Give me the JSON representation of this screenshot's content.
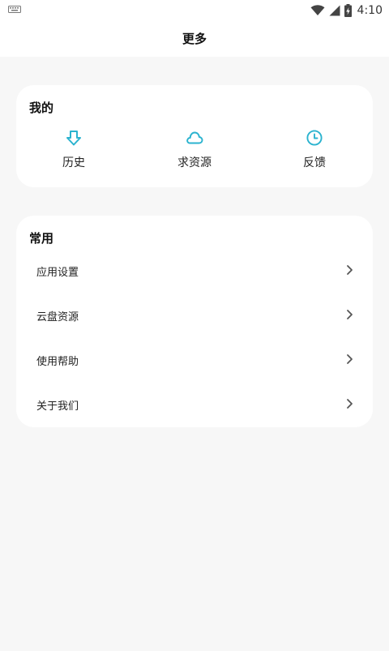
{
  "status_bar": {
    "time": "4:10",
    "icons": [
      "keyboard-icon",
      "wifi-icon",
      "signal-icon",
      "battery-charging-icon"
    ]
  },
  "header": {
    "title": "更多"
  },
  "mine": {
    "title": "我的",
    "items": [
      {
        "label": "历史",
        "icon": "download-arrow-icon"
      },
      {
        "label": "求资源",
        "icon": "cloud-icon"
      },
      {
        "label": "反馈",
        "icon": "clock-icon"
      }
    ]
  },
  "common": {
    "title": "常用",
    "items": [
      {
        "label": "应用设置",
        "icon": "chevron-right-icon"
      },
      {
        "label": "云盘资源",
        "icon": "chevron-right-icon"
      },
      {
        "label": "使用帮助",
        "icon": "chevron-right-icon"
      },
      {
        "label": "关于我们",
        "icon": "chevron-right-icon"
      }
    ]
  },
  "colors": {
    "accent": "#2bb3cf",
    "background": "#f7f7f7",
    "card": "#ffffff",
    "chevron": "#555555"
  }
}
